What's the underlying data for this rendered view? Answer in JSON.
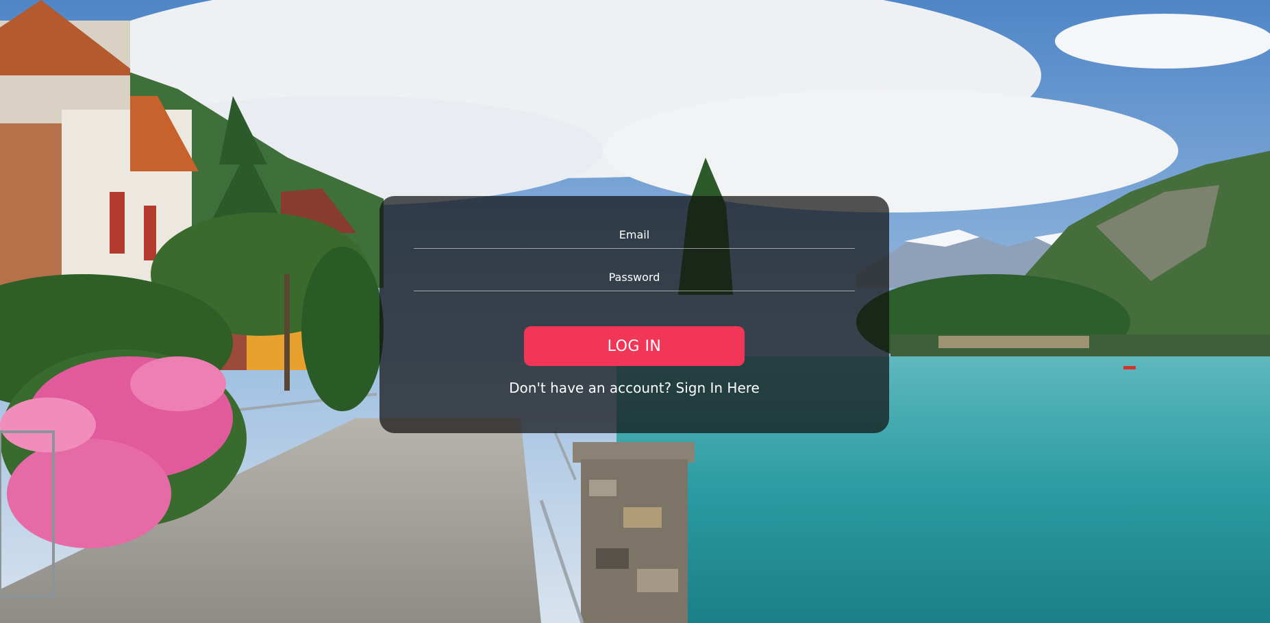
{
  "background": {
    "image": "lakeside-village-landscape",
    "colors": {
      "sky": "#5e8fc9",
      "cloud": "#f1f2f4",
      "lake": "#2d9ea3",
      "mountain": "#3f6f3a",
      "path": "#a9a6a1",
      "flowers": "#e25b9c"
    }
  },
  "login": {
    "email_placeholder": "Email",
    "password_placeholder": "Password",
    "button_label": "LOG IN",
    "signup_prompt": "Don't have an account?",
    "signup_link": "Sign In Here"
  },
  "colors": {
    "accent": "#f23658",
    "card": "rgba(18,18,18,0.72)",
    "text": "#ffffff"
  }
}
